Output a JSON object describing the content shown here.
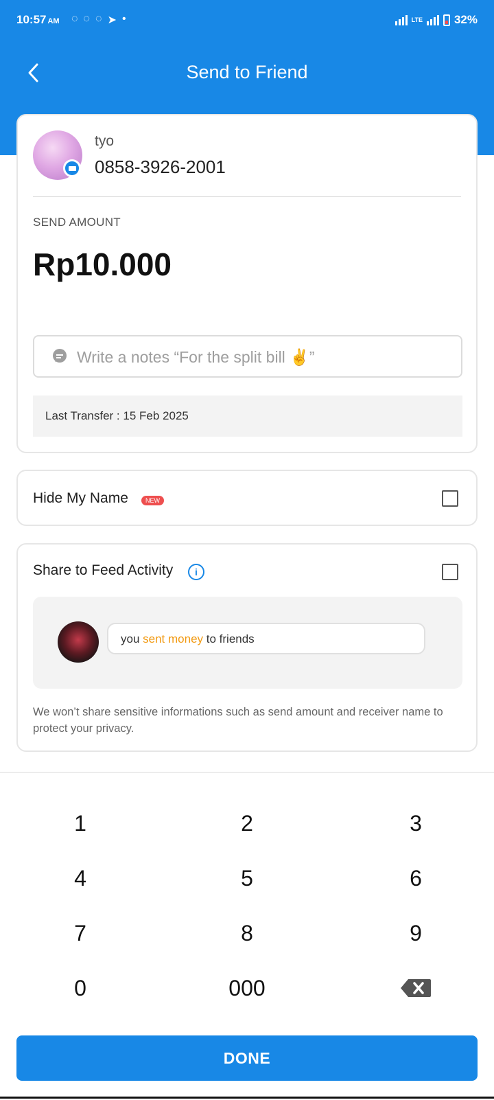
{
  "status_bar": {
    "time": "10:57",
    "ampm": "AM",
    "icons": [
      "whatsapp-icon",
      "whatsapp-business-icon",
      "whatsapp-icon",
      "telegram-icon",
      "dot-icon"
    ],
    "network": "LTE",
    "battery": "32%"
  },
  "header": {
    "title": "Send to Friend"
  },
  "recipient": {
    "name": "tyo",
    "phone": "0858-3926-2001"
  },
  "send": {
    "label": "SEND AMOUNT",
    "amount": "Rp10.000",
    "notes_placeholder": "Write a notes “For the split bill ✌️”",
    "last_transfer": "Last Transfer : 15 Feb 2025"
  },
  "hide_name": {
    "label": "Hide My Name",
    "badge": "NEW",
    "checked": false
  },
  "share_feed": {
    "label": "Share to Feed Activity",
    "checked": false,
    "preview": {
      "before": "you ",
      "highlight": "sent money",
      "after": " to friends"
    },
    "privacy_note": "We won’t share sensitive informations such as send amount and receiver name to protect your privacy."
  },
  "keypad": {
    "keys": [
      "1",
      "2",
      "3",
      "4",
      "5",
      "6",
      "7",
      "8",
      "9",
      "0",
      "000"
    ],
    "done_label": "DONE"
  },
  "colors": {
    "primary": "#1888e6",
    "accent": "#f29a12",
    "badge": "#ee4f4f"
  }
}
